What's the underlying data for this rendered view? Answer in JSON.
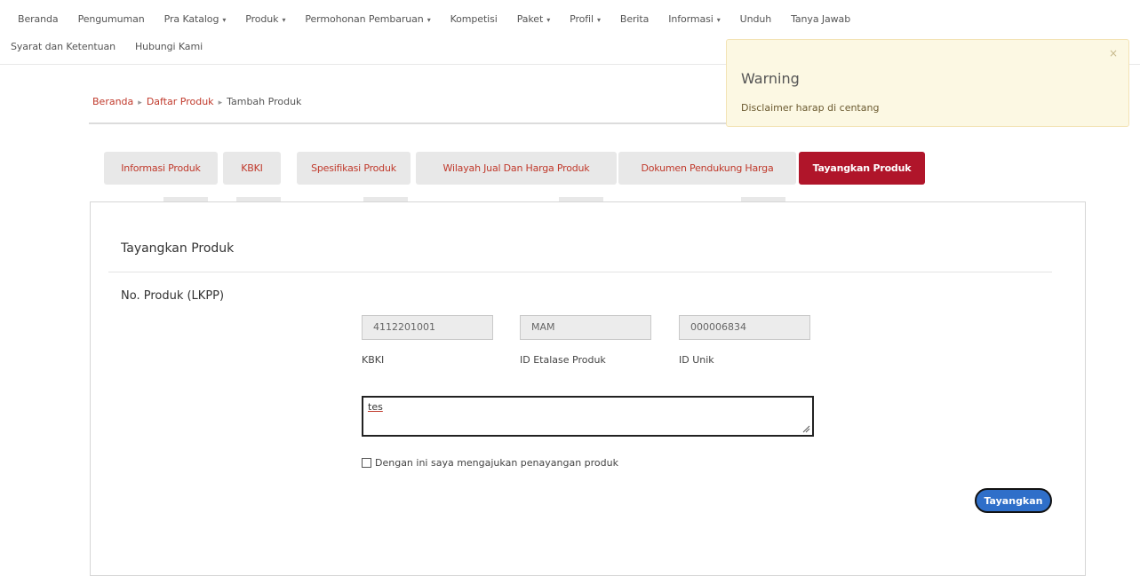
{
  "nav": {
    "row1": [
      {
        "label": "Beranda",
        "caret": false
      },
      {
        "label": "Pengumuman",
        "caret": false
      },
      {
        "label": "Pra Katalog",
        "caret": true
      },
      {
        "label": "Produk",
        "caret": true
      },
      {
        "label": "Permohonan Pembaruan",
        "caret": true
      },
      {
        "label": "Kompetisi",
        "caret": false
      },
      {
        "label": "Paket",
        "caret": true
      },
      {
        "label": "Profil",
        "caret": true
      },
      {
        "label": "Berita",
        "caret": false
      },
      {
        "label": "Informasi",
        "caret": true
      },
      {
        "label": "Unduh",
        "caret": false
      },
      {
        "label": "Tanya Jawab",
        "caret": false
      }
    ],
    "row2": [
      {
        "label": "Syarat dan Ketentuan",
        "caret": false
      },
      {
        "label": "Hubungi Kami",
        "caret": false
      }
    ]
  },
  "breadcrumb": {
    "home": "Beranda",
    "list": "Daftar Produk",
    "current": "Tambah Produk"
  },
  "tabs": [
    {
      "label": "Informasi Produk"
    },
    {
      "label": "KBKI"
    },
    {
      "label": "Spesifikasi Produk"
    },
    {
      "label": "Wilayah Jual Dan Harga Produk"
    },
    {
      "label": "Dokumen Pendukung Harga"
    },
    {
      "label": "Tayangkan Produk",
      "active": true
    }
  ],
  "panel": {
    "title": "Tayangkan Produk",
    "field_label": "No. Produk (LKPP)",
    "kbki_value": "4112201001",
    "kbki_label": "KBKI",
    "etalase_value": "MAM",
    "etalase_label": "ID Etalase Produk",
    "unik_value": "000006834",
    "unik_label": "ID Unik",
    "textarea_value": "tes",
    "checkbox_label": "Dengan ini saya mengajukan penayangan produk",
    "submit_label": "Tayangkan"
  },
  "toast": {
    "title": "Warning",
    "message": "Disclaimer harap di centang",
    "close": "×"
  }
}
